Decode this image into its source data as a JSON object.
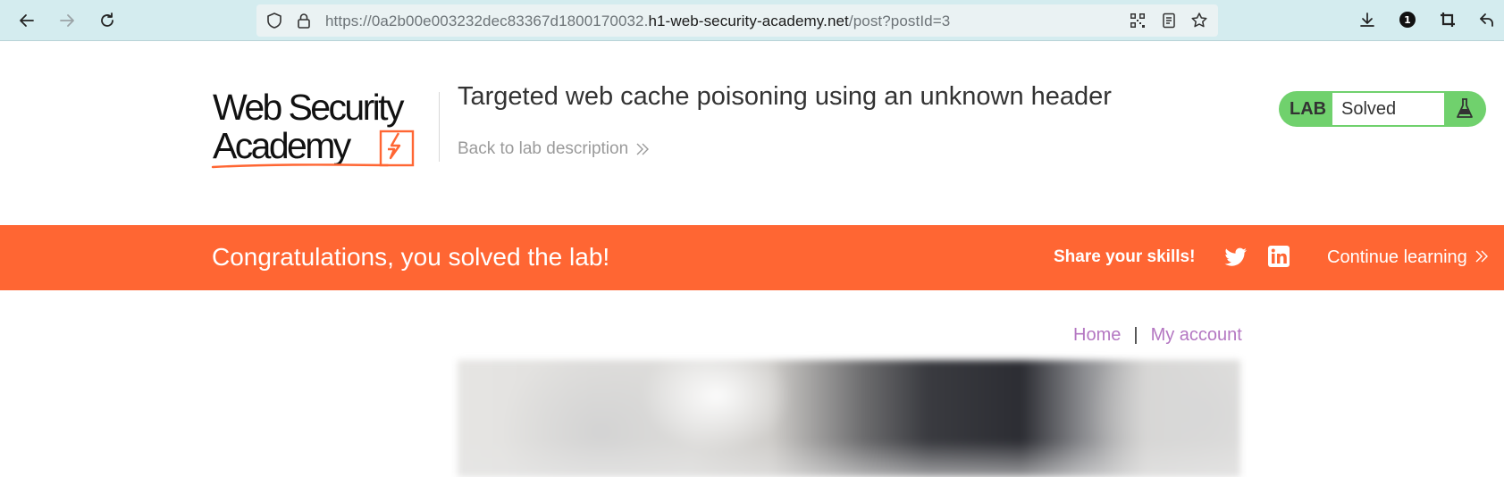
{
  "browser": {
    "url_prefix": "https://0a2b00e003232dec83367d1800170032.",
    "url_domain": "h1-web-security-academy.net",
    "url_path": "/post?postId=3",
    "extension_badge": "1"
  },
  "header": {
    "logo_line1": "Web Security",
    "logo_line2": "Academy",
    "lab_title": "Targeted web cache poisoning using an unknown header",
    "back_link": "Back to lab description",
    "lab_label": "LAB",
    "lab_status": "Solved"
  },
  "banner": {
    "message": "Congratulations, you solved the lab!",
    "share_label": "Share your skills!",
    "continue_label": "Continue learning"
  },
  "nav": {
    "home": "Home",
    "separator": "|",
    "account": "My account"
  },
  "colors": {
    "accent_orange": "#ff6633",
    "status_green": "#70d16d",
    "link_purple": "#b477c2"
  }
}
